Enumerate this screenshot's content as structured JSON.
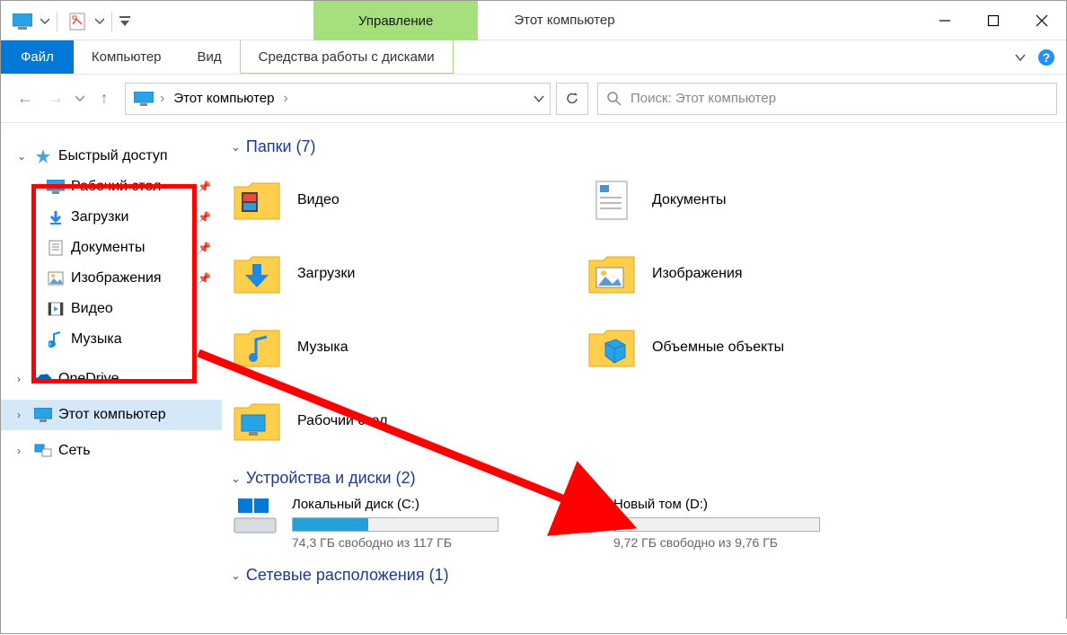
{
  "title": "Этот компьютер",
  "ribbon_context": "Управление",
  "tabs": {
    "file": "Файл",
    "computer": "Компьютер",
    "view": "Вид",
    "disk_tools": "Средства работы с дисками"
  },
  "address": {
    "location": "Этот компьютер"
  },
  "search": {
    "placeholder": "Поиск: Этот компьютер"
  },
  "sidebar": {
    "quick_access": "Быстрый доступ",
    "items": [
      {
        "label": "Рабочий стол"
      },
      {
        "label": "Загрузки"
      },
      {
        "label": "Документы"
      },
      {
        "label": "Изображения"
      },
      {
        "label": "Видео"
      },
      {
        "label": "Музыка"
      }
    ],
    "onedrive": "OneDrive",
    "this_pc": "Этот компьютер",
    "network": "Сеть"
  },
  "sections": {
    "folders": {
      "title": "Папки (7)",
      "items": [
        {
          "label": "Видео"
        },
        {
          "label": "Документы"
        },
        {
          "label": "Загрузки"
        },
        {
          "label": "Изображения"
        },
        {
          "label": "Музыка"
        },
        {
          "label": "Объемные объекты"
        },
        {
          "label": "Рабочий стол"
        }
      ]
    },
    "drives": {
      "title": "Устройства и диски (2)",
      "items": [
        {
          "label": "Локальный диск (C:)",
          "sub": "74,3 ГБ свободно из 117 ГБ",
          "fill": 37
        },
        {
          "label": "Новый том (D:)",
          "sub": "9,72 ГБ свободно из 9,76 ГБ",
          "fill": 1
        }
      ]
    },
    "netloc": {
      "title": "Сетевые расположения (1)"
    }
  }
}
